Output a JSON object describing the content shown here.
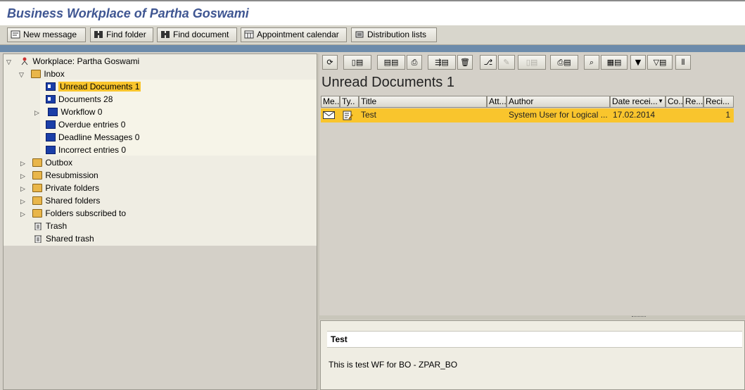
{
  "window": {
    "title": "Business Workplace of Partha Goswami"
  },
  "app_toolbar": {
    "buttons": [
      {
        "label": "New message",
        "icon": "new-message-icon"
      },
      {
        "label": "Find folder",
        "icon": "binoculars-icon"
      },
      {
        "label": "Find document",
        "icon": "binoculars-icon"
      },
      {
        "label": "Appointment calendar",
        "icon": "calendar-icon"
      },
      {
        "label": "Distribution lists",
        "icon": "distribution-list-icon"
      }
    ]
  },
  "tree": {
    "root": "Workplace: Partha Goswami",
    "inbox": "Inbox",
    "inbox_children": [
      {
        "label": "Unread Documents 1",
        "selected": true
      },
      {
        "label": "Documents 28"
      },
      {
        "label": "Workflow 0",
        "expandable": true
      },
      {
        "label": "Overdue entries 0"
      },
      {
        "label": "Deadline Messages 0"
      },
      {
        "label": "Incorrect entries 0"
      }
    ],
    "folders": [
      {
        "label": "Outbox",
        "expandable": true
      },
      {
        "label": "Resubmission",
        "expandable": true
      },
      {
        "label": "Private folders",
        "expandable": true
      },
      {
        "label": "Shared folders",
        "expandable": true
      },
      {
        "label": "Folders subscribed to",
        "expandable": true
      },
      {
        "label": "Trash"
      },
      {
        "label": "Shared trash"
      }
    ]
  },
  "list": {
    "title": "Unread Documents 1",
    "columns": [
      "Me..",
      "Ty..",
      "Title",
      "Att...",
      "Author",
      "Date recei...",
      "Co...",
      "Re...",
      "Reci..."
    ],
    "rows": [
      {
        "title": "Test",
        "author": "System User for Logical ...",
        "date": "17.02.2014",
        "recipients": "1"
      }
    ]
  },
  "preview": {
    "title": "Test",
    "body": "This is test WF for BO - ZPAR_BO"
  },
  "colors": {
    "title_text": "#3f5692",
    "selection": "#f9c52d",
    "header_strip": "#6c8bab"
  }
}
